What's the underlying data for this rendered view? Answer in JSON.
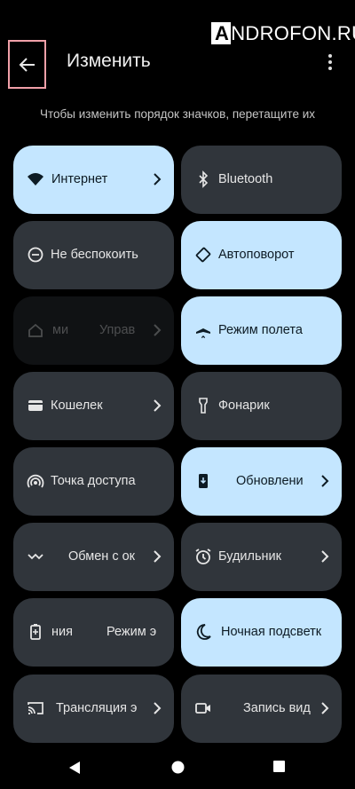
{
  "watermark": {
    "first": "A",
    "rest": "NDROFON.RU"
  },
  "header": {
    "title": "Изменить"
  },
  "hint": "Чтобы изменить порядок значков, перетащите их",
  "tiles": [
    {
      "label": "Интернет"
    },
    {
      "label": "Bluetooth"
    },
    {
      "label": "Не беспокоить"
    },
    {
      "label": "Автоповорот"
    },
    {
      "label": "ми",
      "label2": "Управ"
    },
    {
      "label": "Режим полета"
    },
    {
      "label": "Кошелек"
    },
    {
      "label": "Фонарик"
    },
    {
      "label": "Точка доступа"
    },
    {
      "label": "Обновлени"
    },
    {
      "label": "Обмен с ок"
    },
    {
      "label": "Будильник"
    },
    {
      "label": "ния",
      "label2": "Режим э"
    },
    {
      "label": "Ночная подсветк"
    },
    {
      "label": "Трансляция э"
    },
    {
      "label": "Запись вид"
    }
  ],
  "colors": {
    "tile_on": "#c4e6ff",
    "tile_off": "#30353b",
    "background": "#000000"
  }
}
